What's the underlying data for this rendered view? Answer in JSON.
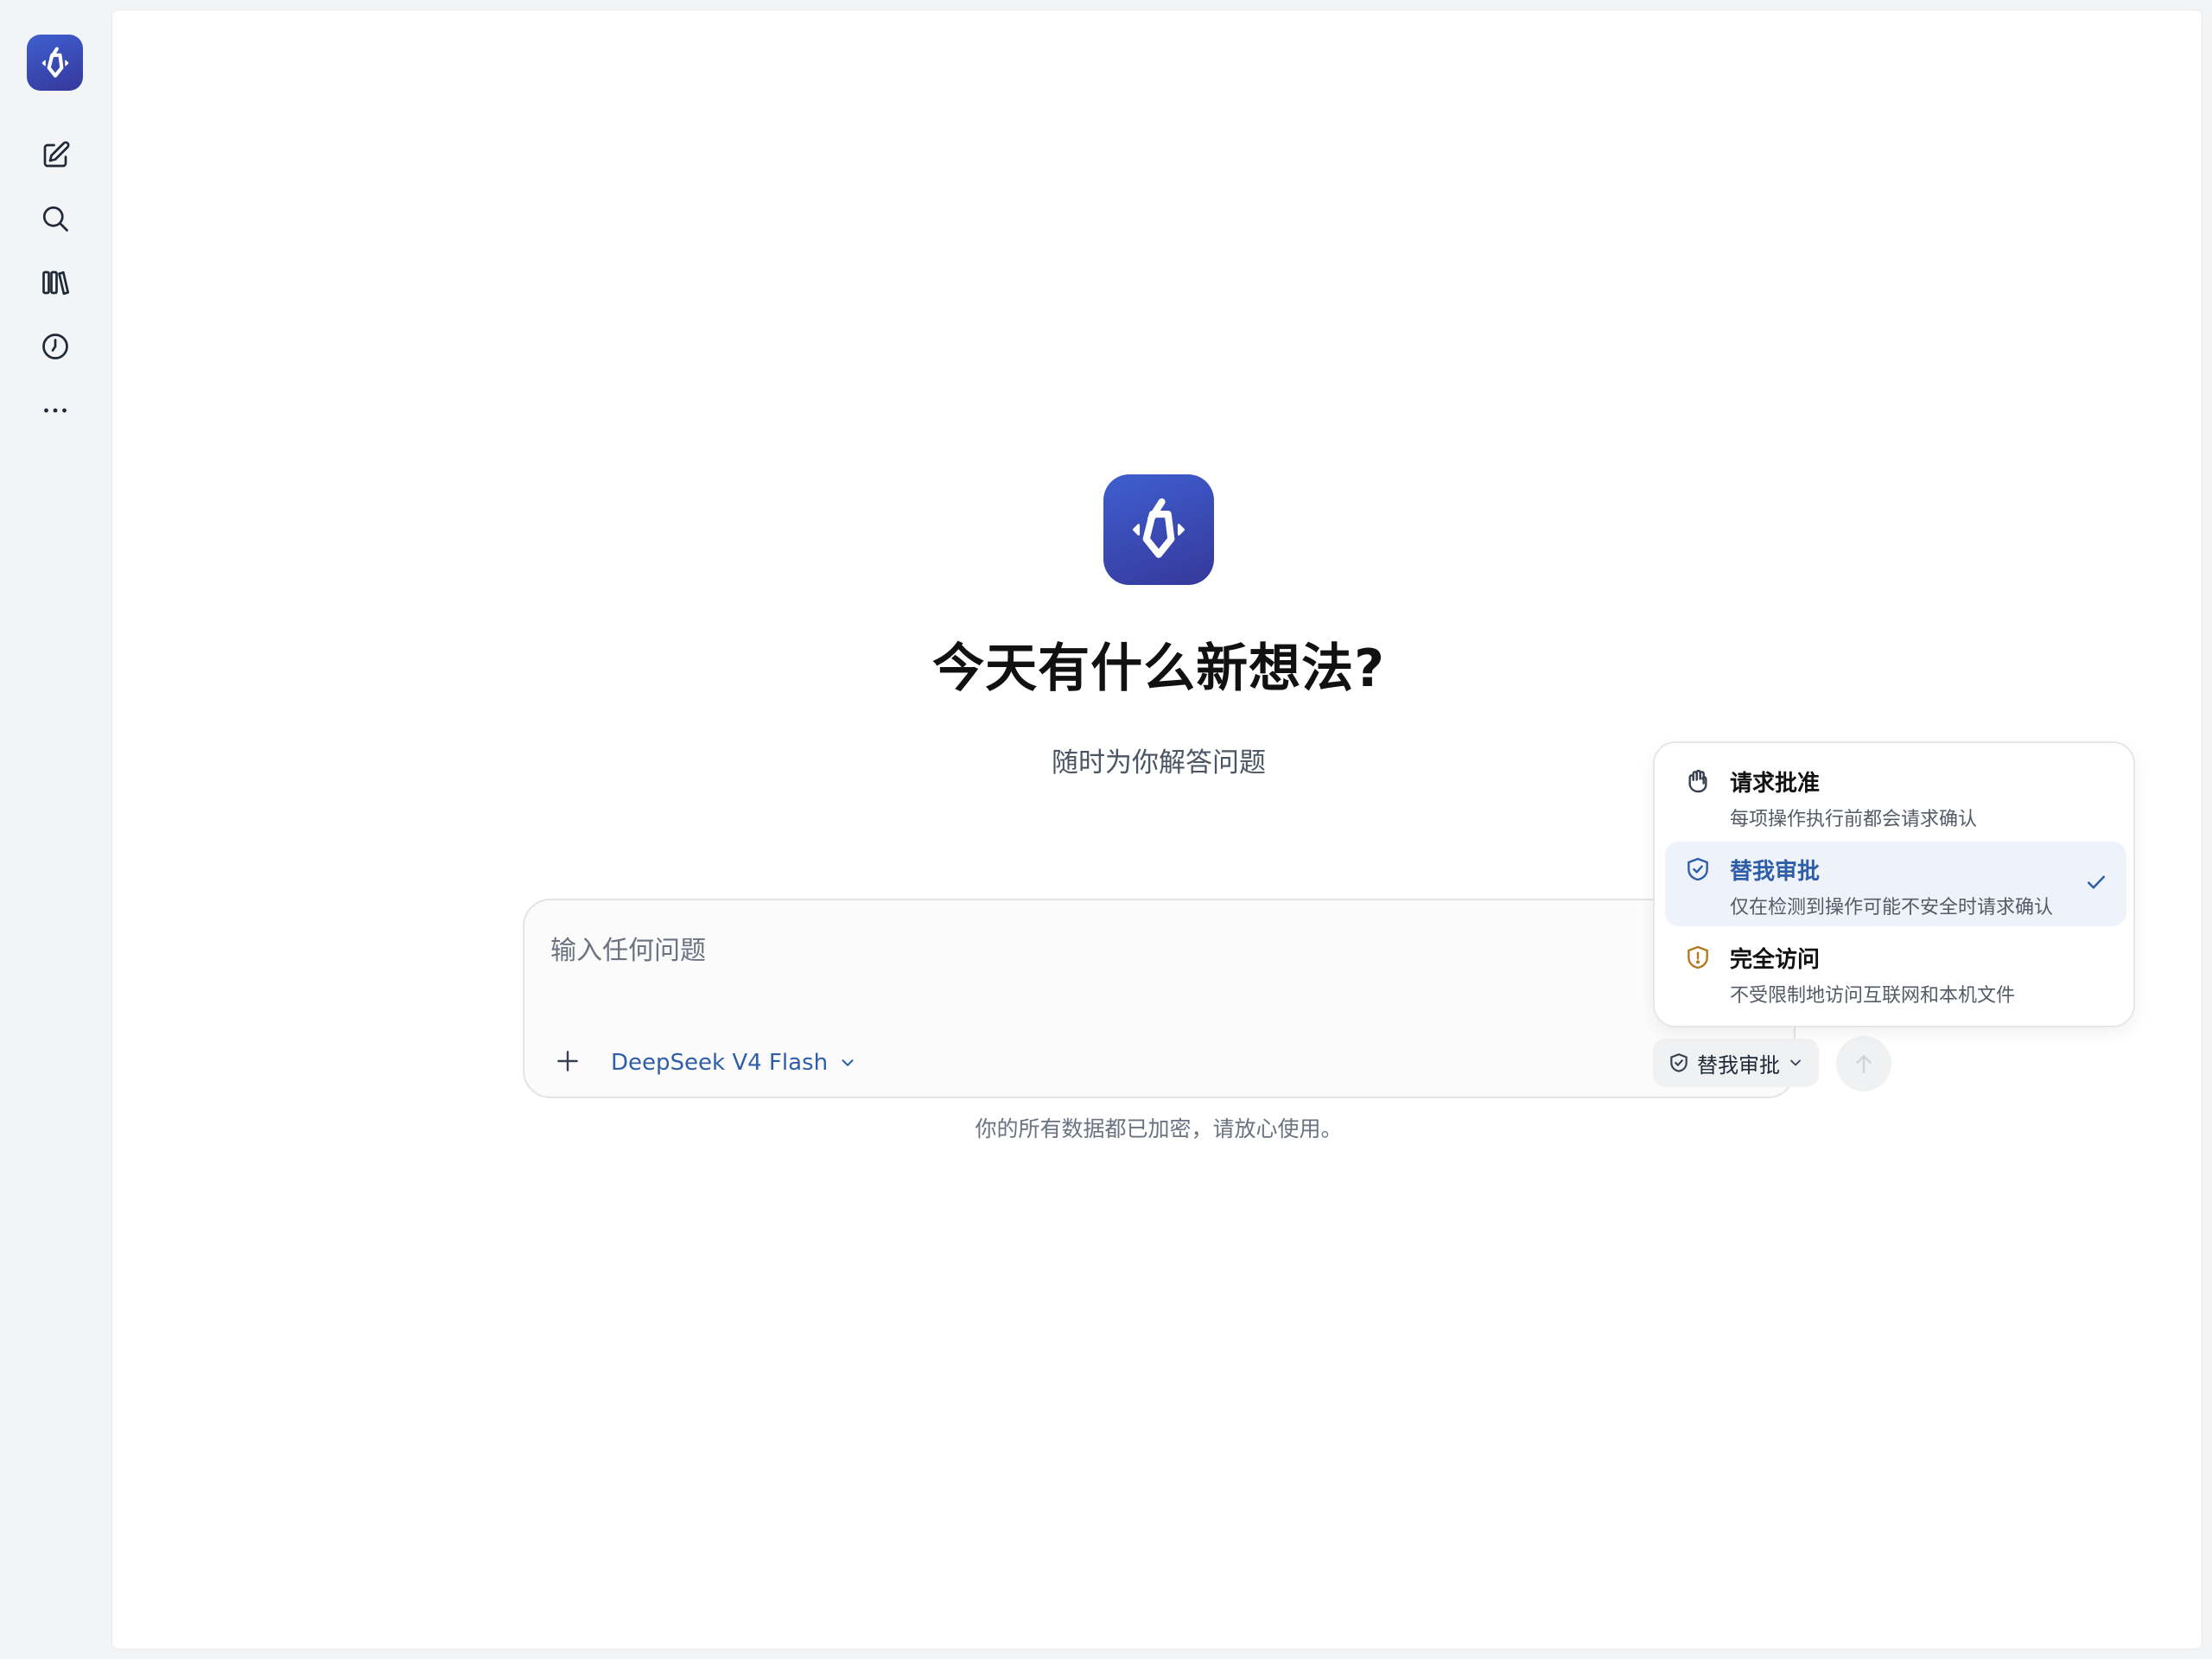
{
  "sidebar": {
    "logo_icon": "app-logo-icon",
    "items": [
      {
        "name": "new-chat",
        "icon": "edit-icon"
      },
      {
        "name": "search",
        "icon": "search-icon"
      },
      {
        "name": "library",
        "icon": "library-icon"
      },
      {
        "name": "history",
        "icon": "clock-icon"
      },
      {
        "name": "more",
        "icon": "more-icon"
      }
    ]
  },
  "hero": {
    "title": "今天有什么新想法?",
    "subtitle": "随时为你解答问题"
  },
  "composer": {
    "placeholder": "输入任何问题",
    "model_label": "DeepSeek V4 Flash",
    "mode_label": "替我审批",
    "footer_note": "你的所有数据都已加密，请放心使用。"
  },
  "approval_menu": {
    "options": [
      {
        "title": "请求批准",
        "description": "每项操作执行前都会请求确认",
        "icon": "hand-icon",
        "selected": false
      },
      {
        "title": "替我审批",
        "description": "仅在检测到操作可能不安全时请求确认",
        "icon": "shield-check-icon",
        "selected": true
      },
      {
        "title": "完全访问",
        "description": "不受限制地访问互联网和本机文件",
        "icon": "shield-alert-icon",
        "selected": false
      }
    ]
  },
  "colors": {
    "accent": "#2f5ea8",
    "brand_gradient_start": "#3f5fd0",
    "brand_gradient_end": "#35389a",
    "warning": "#b7791f"
  }
}
